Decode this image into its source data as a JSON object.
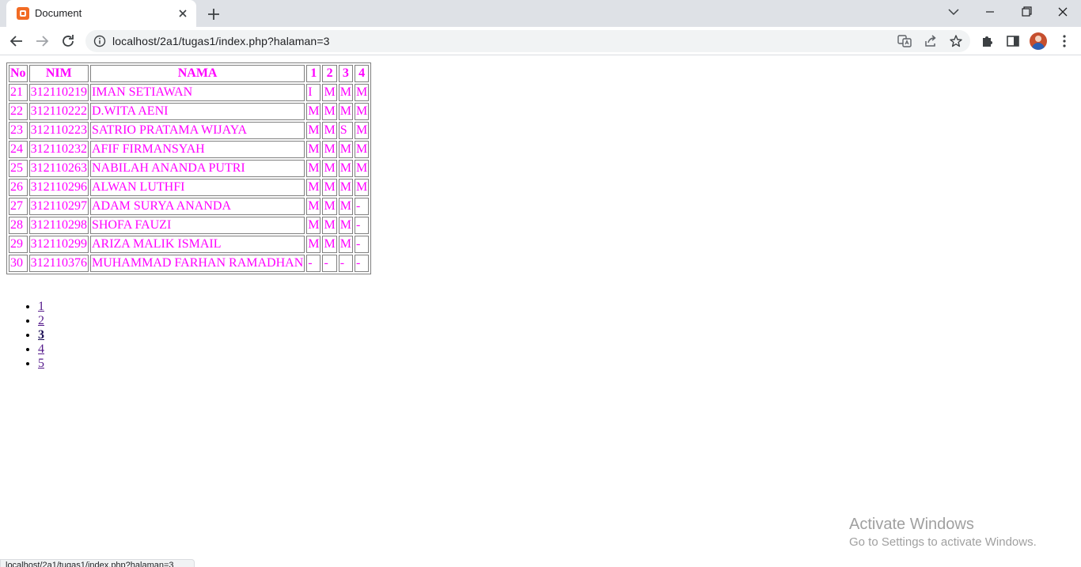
{
  "browser": {
    "tab_title": "Document",
    "url": "localhost/2a1/tugas1/index.php?halaman=3",
    "status_url": "localhost/2a1/tugas1/index.php?halaman=3"
  },
  "table": {
    "headers": [
      "No",
      "NIM",
      "NAMA",
      "1",
      "2",
      "3",
      "4"
    ],
    "rows": [
      [
        "21",
        "312110219",
        "IMAN SETIAWAN",
        "I",
        "M",
        "M",
        "M"
      ],
      [
        "22",
        "312110222",
        "D.WITA AENI",
        "M",
        "M",
        "M",
        "M"
      ],
      [
        "23",
        "312110223",
        "SATRIO PRATAMA WIJAYA",
        "M",
        "M",
        "S",
        "M"
      ],
      [
        "24",
        "312110232",
        "AFIF FIRMANSYAH",
        "M",
        "M",
        "M",
        "M"
      ],
      [
        "25",
        "312110263",
        "NABILAH ANANDA PUTRI",
        "M",
        "M",
        "M",
        "M"
      ],
      [
        "26",
        "312110296",
        "ALWAN LUTHFI",
        "M",
        "M",
        "M",
        "M"
      ],
      [
        "27",
        "312110297",
        "ADAM SURYA ANANDA",
        "M",
        "M",
        "M",
        "-"
      ],
      [
        "28",
        "312110298",
        "SHOFA FAUZI",
        "M",
        "M",
        "M",
        "-"
      ],
      [
        "29",
        "312110299",
        "ARIZA MALIK ISMAIL",
        "M",
        "M",
        "M",
        "-"
      ],
      [
        "30",
        "312110376",
        "MUHAMMAD FARHAN RAMADHAN",
        "-",
        "-",
        "-",
        "-"
      ]
    ]
  },
  "pagination": {
    "pages": [
      "1",
      "2",
      "3",
      "4",
      "5"
    ],
    "current": "3"
  },
  "watermark": {
    "title": "Activate Windows",
    "subtitle": "Go to Settings to activate Windows."
  },
  "colors": {
    "table_text": "#ff00ff",
    "link": "#551a8b"
  },
  "icons": {
    "tab_favicon": "xampp-icon",
    "back": "back-arrow-icon",
    "forward": "forward-arrow-icon",
    "reload": "reload-icon",
    "site_info": "info-icon",
    "translate": "translate-icon",
    "share": "share-icon",
    "bookmark": "star-icon",
    "extensions": "puzzle-icon",
    "side_panel": "side-panel-icon",
    "menu": "kebab-menu-icon"
  }
}
